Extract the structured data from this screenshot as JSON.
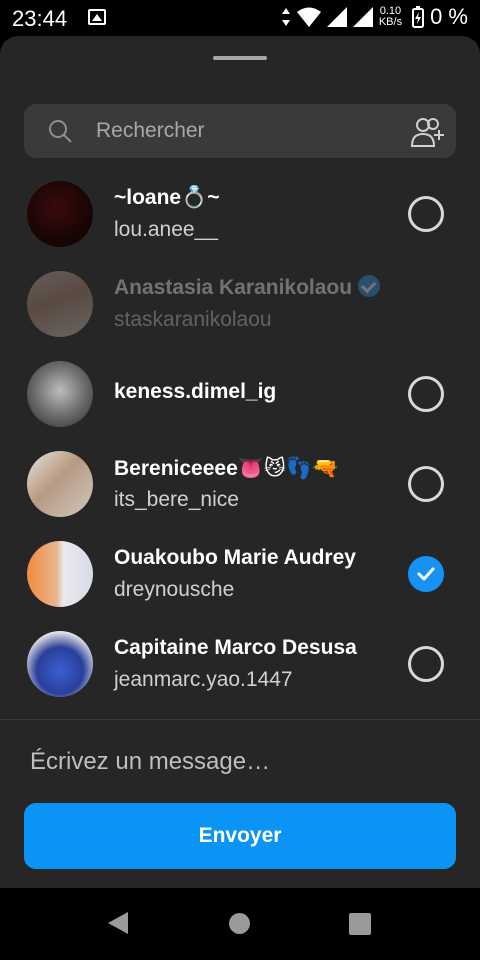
{
  "status_bar": {
    "time": "23:44",
    "net_speed_value": "0.10",
    "net_speed_unit": "KB/s",
    "battery_percent": "0 %",
    "icons": [
      "gallery-icon",
      "data-arrows-icon",
      "wifi-icon",
      "signal-icon",
      "signal-icon",
      "battery-charging-icon"
    ]
  },
  "search": {
    "placeholder": "Rechercher",
    "icon": "search-icon",
    "add_icon": "add-people-icon"
  },
  "contacts": [
    {
      "name": "~loane💍~",
      "username": "lou.anee__",
      "selected": false,
      "dimmed": false
    },
    {
      "name": "Anastasia Karanikolaou",
      "username": "staskaranikolaou",
      "verified": true,
      "dimmed": true
    },
    {
      "name": "keness.dimel_ig",
      "username": "",
      "selected": false,
      "dimmed": false
    },
    {
      "name": "Bereniceeee👅😼👣🔫",
      "username": "its_bere_nice",
      "selected": false,
      "dimmed": false
    },
    {
      "name": "Ouakoubo Marie Audrey",
      "username": "dreynousche",
      "selected": true,
      "dimmed": false
    },
    {
      "name": "Capitaine Marco Desusa",
      "username": "jeanmarc.yao.1447",
      "selected": false,
      "dimmed": false
    }
  ],
  "composer": {
    "placeholder": "Écrivez un message…",
    "send_label": "Envoyer"
  },
  "colors": {
    "accent": "#0a95f6",
    "sheet_bg": "#262626",
    "search_bg": "#3a3a3a"
  }
}
